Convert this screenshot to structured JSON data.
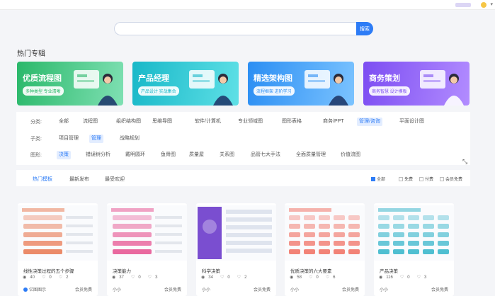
{
  "search": {
    "placeholder": "",
    "button": "搜索"
  },
  "section_title": "热门专辑",
  "banners": [
    {
      "title": "优质流程图",
      "sub": "多种类型 专业清晰",
      "color1": "#2ab86a",
      "color2": "#7fe0b3"
    },
    {
      "title": "产品经理",
      "sub": "产品设计 实战集合",
      "color1": "#18b8c8",
      "color2": "#5fe0e6"
    },
    {
      "title": "精选架构图",
      "sub": "流程框架 进阶学习",
      "color1": "#2b8ef3",
      "color2": "#7bc3ff"
    },
    {
      "title": "商务策划",
      "sub": "商务智慧 设计模板",
      "color1": "#7c4df2",
      "color2": "#b28cff"
    }
  ],
  "filters": {
    "category": {
      "label": "分类:",
      "items": [
        "全部",
        "流程图",
        "组织结构图",
        "思维导图",
        "软件/计算机",
        "专业领域图",
        "图形表格",
        "商务/PPT",
        "管理/咨询",
        "平面设计图"
      ],
      "active": "管理/咨询"
    },
    "subcategory": {
      "label": "子类:",
      "items": [
        "项目管理",
        "管理",
        "战略规划"
      ],
      "active": "管理"
    },
    "shape": {
      "label": "图形:",
      "items": [
        "决策",
        "错误树分析",
        "戴明圆环",
        "鱼骨图",
        "质量屋",
        "关系图",
        "品管七大手法",
        "全面质量管理",
        "价值流图"
      ],
      "active": "决策"
    }
  },
  "sort": {
    "tabs": [
      "热门模板",
      "最新发布",
      "最受欢迎"
    ],
    "active": "热门模板",
    "checks": [
      {
        "label": "全部",
        "on": true
      },
      {
        "label": "免费",
        "on": false
      },
      {
        "label": "付费",
        "on": false
      },
      {
        "label": "会员免费",
        "on": false
      }
    ]
  },
  "cards": [
    {
      "title": "线性决策过程的五个步骤",
      "views": "40",
      "likes": "0",
      "favs": "2",
      "author": "亿图图示",
      "badge": "会员免费",
      "theme": "#e8734a"
    },
    {
      "title": "决策能力",
      "views": "37",
      "likes": "0",
      "favs": "3",
      "author": "小小",
      "badge": "会员免费",
      "theme": "#e64a8b"
    },
    {
      "title": "科学决策",
      "views": "34",
      "likes": "0",
      "favs": "2",
      "author": "小小",
      "badge": "会员免费",
      "theme": "#7a4ed0"
    },
    {
      "title": "优质决策的六大要素",
      "views": "58",
      "likes": "0",
      "favs": "6",
      "author": "小小",
      "badge": "会员免费",
      "theme": "#f06a5c"
    },
    {
      "title": "产品决策",
      "views": "116",
      "likes": "0",
      "favs": "3",
      "author": "小小",
      "badge": "会员免费",
      "theme": "#2db2c8"
    }
  ]
}
